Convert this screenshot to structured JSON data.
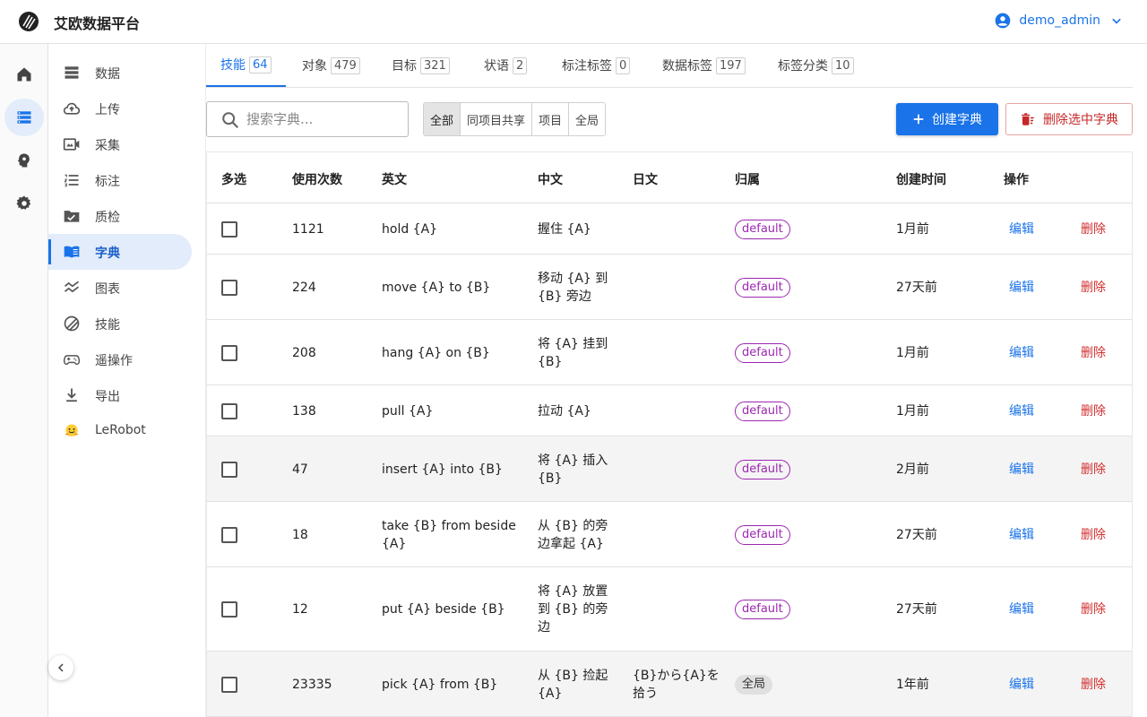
{
  "header": {
    "app_title": "艾欧数据平台",
    "username": "demo_admin"
  },
  "rail": [
    "home-icon",
    "dataset-icon",
    "brain-icon",
    "settings-icon"
  ],
  "sidebar": {
    "items": [
      {
        "label": "数据",
        "icon": "storage-icon"
      },
      {
        "label": "上传",
        "icon": "cloud-upload-icon"
      },
      {
        "label": "采集",
        "icon": "camera-video-icon"
      },
      {
        "label": "标注",
        "icon": "list-numbered-icon"
      },
      {
        "label": "质检",
        "icon": "folder-check-icon"
      },
      {
        "label": "字典",
        "icon": "book-icon"
      },
      {
        "label": "图表",
        "icon": "chart-line-icon"
      },
      {
        "label": "技能",
        "icon": "skill-icon"
      },
      {
        "label": "遥操作",
        "icon": "gamepad-icon"
      },
      {
        "label": "导出",
        "icon": "download-icon"
      },
      {
        "label": "LeRobot",
        "icon": "hugging-face-icon"
      }
    ],
    "active_index": 5
  },
  "tabs": [
    {
      "label": "技能",
      "count": "64"
    },
    {
      "label": "对象",
      "count": "479"
    },
    {
      "label": "目标",
      "count": "321"
    },
    {
      "label": "状语",
      "count": "2"
    },
    {
      "label": "标注标签",
      "count": "0"
    },
    {
      "label": "数据标签",
      "count": "197"
    },
    {
      "label": "标签分类",
      "count": "10"
    }
  ],
  "search": {
    "placeholder": "搜索字典...",
    "value": ""
  },
  "scope_filter": [
    "全部",
    "同项目共享",
    "项目",
    "全局"
  ],
  "actions": {
    "create": "创建字典",
    "delete_selected": "删除选中字典"
  },
  "table": {
    "columns": [
      "多选",
      "使用次数",
      "英文",
      "中文",
      "日文",
      "归属",
      "创建时间",
      "操作"
    ],
    "edit_label": "编辑",
    "delete_label": "删除",
    "rows": [
      {
        "count": "1121",
        "en": "hold {A}",
        "zh": [
          "握住 {A}"
        ],
        "ja": [],
        "owner": "default",
        "created": "1月前"
      },
      {
        "count": "224",
        "en": "move {A} to {B}",
        "zh": [
          "移动 {A} 到",
          "{B} 旁边"
        ],
        "ja": [],
        "owner": "default",
        "created": "27天前"
      },
      {
        "count": "208",
        "en": "hang {A} on {B}",
        "zh": [
          "将 {A} 挂到",
          "{B}"
        ],
        "ja": [],
        "owner": "default",
        "created": "1月前"
      },
      {
        "count": "138",
        "en": "pull {A}",
        "zh": [
          "拉动 {A}"
        ],
        "ja": [],
        "owner": "default",
        "created": "1月前"
      },
      {
        "count": "47",
        "en": "insert {A} into {B}",
        "zh": [
          "将 {A} 插入",
          "{B}"
        ],
        "ja": [],
        "owner": "default",
        "created": "2月前"
      },
      {
        "count": "18",
        "en": "take {B} from beside {A}",
        "zh": [
          "从 {B} 的旁",
          "边拿起 {A}"
        ],
        "ja": [],
        "owner": "default",
        "created": "27天前"
      },
      {
        "count": "12",
        "en": "put {A} beside {B}",
        "zh": [
          "将 {A} 放置",
          "到 {B} 的旁",
          "边"
        ],
        "ja": [],
        "owner": "default",
        "created": "27天前"
      },
      {
        "count": "23335",
        "en": "pick {A} from {B}",
        "zh": [
          "从 {B} 捡起",
          "{A}"
        ],
        "ja": [
          "{B}から{A}を",
          "拾う"
        ],
        "owner": "全局",
        "created": "1年前"
      }
    ]
  },
  "colors": {
    "accent": "#1a73e8",
    "danger": "#d32f2f",
    "badge": "#9c27b0"
  }
}
